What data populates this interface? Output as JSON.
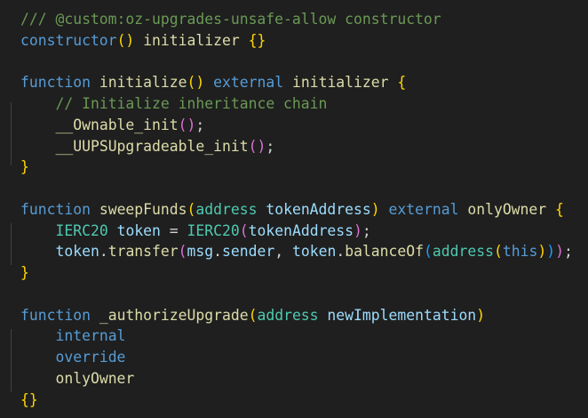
{
  "editor": {
    "colors": {
      "background": "#1f1f1f",
      "comment": "#6a9955",
      "keyword": "#569cd6",
      "function": "#dcdcaa",
      "type": "#4ec9b0",
      "variable": "#9cdcfe",
      "text": "#d4d4d4",
      "bracket_level_1": "#ffd700",
      "bracket_level_2": "#da70d6",
      "bracket_level_3": "#179fff"
    },
    "lines": [
      {
        "tokens": [
          {
            "t": "/// @custom:oz-upgrades-unsafe-allow constructor",
            "c": "cmt"
          }
        ]
      },
      {
        "tokens": [
          {
            "t": "constructor",
            "c": "kw"
          },
          {
            "t": "()",
            "c": "br1"
          },
          {
            "t": " ",
            "c": "txt"
          },
          {
            "t": "initializer",
            "c": "fn"
          },
          {
            "t": " ",
            "c": "txt"
          },
          {
            "t": "{}",
            "c": "br1"
          }
        ]
      },
      {
        "tokens": []
      },
      {
        "tokens": [
          {
            "t": "function",
            "c": "kw"
          },
          {
            "t": " ",
            "c": "txt"
          },
          {
            "t": "initialize",
            "c": "fn"
          },
          {
            "t": "()",
            "c": "br1"
          },
          {
            "t": " ",
            "c": "txt"
          },
          {
            "t": "external",
            "c": "kw"
          },
          {
            "t": " ",
            "c": "txt"
          },
          {
            "t": "initializer",
            "c": "fn"
          },
          {
            "t": " ",
            "c": "txt"
          },
          {
            "t": "{",
            "c": "br1"
          }
        ]
      },
      {
        "tokens": [
          {
            "t": "    ",
            "c": "txt"
          },
          {
            "t": "// Initialize inheritance chain",
            "c": "cmt"
          }
        ]
      },
      {
        "tokens": [
          {
            "t": "    ",
            "c": "txt"
          },
          {
            "t": "__Ownable_init",
            "c": "fn"
          },
          {
            "t": "()",
            "c": "br2"
          },
          {
            "t": ";",
            "c": "txt"
          }
        ]
      },
      {
        "tokens": [
          {
            "t": "    ",
            "c": "txt"
          },
          {
            "t": "__UUPSUpgradeable_init",
            "c": "fn"
          },
          {
            "t": "()",
            "c": "br2"
          },
          {
            "t": ";",
            "c": "txt"
          }
        ]
      },
      {
        "tokens": [
          {
            "t": "}",
            "c": "br1"
          }
        ]
      },
      {
        "tokens": []
      },
      {
        "tokens": [
          {
            "t": "function",
            "c": "kw"
          },
          {
            "t": " ",
            "c": "txt"
          },
          {
            "t": "sweepFunds",
            "c": "fn"
          },
          {
            "t": "(",
            "c": "br1"
          },
          {
            "t": "address",
            "c": "ty"
          },
          {
            "t": " ",
            "c": "txt"
          },
          {
            "t": "tokenAddress",
            "c": "var"
          },
          {
            "t": ")",
            "c": "br1"
          },
          {
            "t": " ",
            "c": "txt"
          },
          {
            "t": "external",
            "c": "kw"
          },
          {
            "t": " ",
            "c": "txt"
          },
          {
            "t": "onlyOwner",
            "c": "fn"
          },
          {
            "t": " ",
            "c": "txt"
          },
          {
            "t": "{",
            "c": "br1"
          }
        ]
      },
      {
        "tokens": [
          {
            "t": "    ",
            "c": "txt"
          },
          {
            "t": "IERC20",
            "c": "ty"
          },
          {
            "t": " ",
            "c": "txt"
          },
          {
            "t": "token",
            "c": "var"
          },
          {
            "t": " = ",
            "c": "txt"
          },
          {
            "t": "IERC20",
            "c": "ty"
          },
          {
            "t": "(",
            "c": "br2"
          },
          {
            "t": "tokenAddress",
            "c": "var"
          },
          {
            "t": ")",
            "c": "br2"
          },
          {
            "t": ";",
            "c": "txt"
          }
        ]
      },
      {
        "tokens": [
          {
            "t": "    ",
            "c": "txt"
          },
          {
            "t": "token",
            "c": "var"
          },
          {
            "t": ".",
            "c": "txt"
          },
          {
            "t": "transfer",
            "c": "fn"
          },
          {
            "t": "(",
            "c": "br2"
          },
          {
            "t": "msg",
            "c": "var"
          },
          {
            "t": ".",
            "c": "txt"
          },
          {
            "t": "sender",
            "c": "var"
          },
          {
            "t": ", ",
            "c": "txt"
          },
          {
            "t": "token",
            "c": "var"
          },
          {
            "t": ".",
            "c": "txt"
          },
          {
            "t": "balanceOf",
            "c": "fn"
          },
          {
            "t": "(",
            "c": "br3"
          },
          {
            "t": "address",
            "c": "ty"
          },
          {
            "t": "(",
            "c": "br1"
          },
          {
            "t": "this",
            "c": "kw"
          },
          {
            "t": ")",
            "c": "br1"
          },
          {
            "t": ")",
            "c": "br3"
          },
          {
            "t": ")",
            "c": "br2"
          },
          {
            "t": ";",
            "c": "txt"
          }
        ]
      },
      {
        "tokens": [
          {
            "t": "}",
            "c": "br1"
          }
        ]
      },
      {
        "tokens": []
      },
      {
        "tokens": [
          {
            "t": "function",
            "c": "kw"
          },
          {
            "t": " ",
            "c": "txt"
          },
          {
            "t": "_authorizeUpgrade",
            "c": "fn"
          },
          {
            "t": "(",
            "c": "br1"
          },
          {
            "t": "address",
            "c": "ty"
          },
          {
            "t": " ",
            "c": "txt"
          },
          {
            "t": "newImplementation",
            "c": "var"
          },
          {
            "t": ")",
            "c": "br1"
          }
        ]
      },
      {
        "tokens": [
          {
            "t": "    ",
            "c": "txt"
          },
          {
            "t": "internal",
            "c": "kw"
          }
        ]
      },
      {
        "tokens": [
          {
            "t": "    ",
            "c": "txt"
          },
          {
            "t": "override",
            "c": "kw"
          }
        ]
      },
      {
        "tokens": [
          {
            "t": "    ",
            "c": "txt"
          },
          {
            "t": "onlyOwner",
            "c": "fn"
          }
        ]
      },
      {
        "tokens": [
          {
            "t": "{}",
            "c": "br1"
          }
        ]
      }
    ]
  }
}
